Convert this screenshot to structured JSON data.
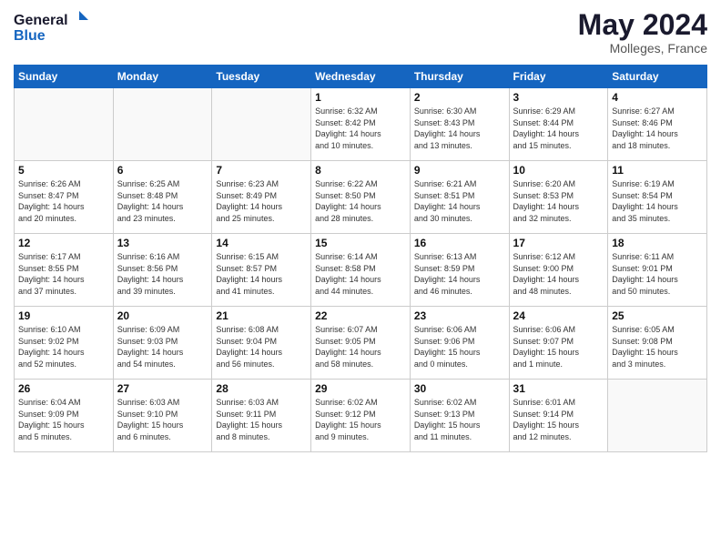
{
  "header": {
    "logo_general": "General",
    "logo_blue": "Blue",
    "month_year": "May 2024",
    "location": "Molleges, France"
  },
  "weekdays": [
    "Sunday",
    "Monday",
    "Tuesday",
    "Wednesday",
    "Thursday",
    "Friday",
    "Saturday"
  ],
  "weeks": [
    [
      {
        "day": "",
        "info": ""
      },
      {
        "day": "",
        "info": ""
      },
      {
        "day": "",
        "info": ""
      },
      {
        "day": "1",
        "info": "Sunrise: 6:32 AM\nSunset: 8:42 PM\nDaylight: 14 hours\nand 10 minutes."
      },
      {
        "day": "2",
        "info": "Sunrise: 6:30 AM\nSunset: 8:43 PM\nDaylight: 14 hours\nand 13 minutes."
      },
      {
        "day": "3",
        "info": "Sunrise: 6:29 AM\nSunset: 8:44 PM\nDaylight: 14 hours\nand 15 minutes."
      },
      {
        "day": "4",
        "info": "Sunrise: 6:27 AM\nSunset: 8:46 PM\nDaylight: 14 hours\nand 18 minutes."
      }
    ],
    [
      {
        "day": "5",
        "info": "Sunrise: 6:26 AM\nSunset: 8:47 PM\nDaylight: 14 hours\nand 20 minutes."
      },
      {
        "day": "6",
        "info": "Sunrise: 6:25 AM\nSunset: 8:48 PM\nDaylight: 14 hours\nand 23 minutes."
      },
      {
        "day": "7",
        "info": "Sunrise: 6:23 AM\nSunset: 8:49 PM\nDaylight: 14 hours\nand 25 minutes."
      },
      {
        "day": "8",
        "info": "Sunrise: 6:22 AM\nSunset: 8:50 PM\nDaylight: 14 hours\nand 28 minutes."
      },
      {
        "day": "9",
        "info": "Sunrise: 6:21 AM\nSunset: 8:51 PM\nDaylight: 14 hours\nand 30 minutes."
      },
      {
        "day": "10",
        "info": "Sunrise: 6:20 AM\nSunset: 8:53 PM\nDaylight: 14 hours\nand 32 minutes."
      },
      {
        "day": "11",
        "info": "Sunrise: 6:19 AM\nSunset: 8:54 PM\nDaylight: 14 hours\nand 35 minutes."
      }
    ],
    [
      {
        "day": "12",
        "info": "Sunrise: 6:17 AM\nSunset: 8:55 PM\nDaylight: 14 hours\nand 37 minutes."
      },
      {
        "day": "13",
        "info": "Sunrise: 6:16 AM\nSunset: 8:56 PM\nDaylight: 14 hours\nand 39 minutes."
      },
      {
        "day": "14",
        "info": "Sunrise: 6:15 AM\nSunset: 8:57 PM\nDaylight: 14 hours\nand 41 minutes."
      },
      {
        "day": "15",
        "info": "Sunrise: 6:14 AM\nSunset: 8:58 PM\nDaylight: 14 hours\nand 44 minutes."
      },
      {
        "day": "16",
        "info": "Sunrise: 6:13 AM\nSunset: 8:59 PM\nDaylight: 14 hours\nand 46 minutes."
      },
      {
        "day": "17",
        "info": "Sunrise: 6:12 AM\nSunset: 9:00 PM\nDaylight: 14 hours\nand 48 minutes."
      },
      {
        "day": "18",
        "info": "Sunrise: 6:11 AM\nSunset: 9:01 PM\nDaylight: 14 hours\nand 50 minutes."
      }
    ],
    [
      {
        "day": "19",
        "info": "Sunrise: 6:10 AM\nSunset: 9:02 PM\nDaylight: 14 hours\nand 52 minutes."
      },
      {
        "day": "20",
        "info": "Sunrise: 6:09 AM\nSunset: 9:03 PM\nDaylight: 14 hours\nand 54 minutes."
      },
      {
        "day": "21",
        "info": "Sunrise: 6:08 AM\nSunset: 9:04 PM\nDaylight: 14 hours\nand 56 minutes."
      },
      {
        "day": "22",
        "info": "Sunrise: 6:07 AM\nSunset: 9:05 PM\nDaylight: 14 hours\nand 58 minutes."
      },
      {
        "day": "23",
        "info": "Sunrise: 6:06 AM\nSunset: 9:06 PM\nDaylight: 15 hours\nand 0 minutes."
      },
      {
        "day": "24",
        "info": "Sunrise: 6:06 AM\nSunset: 9:07 PM\nDaylight: 15 hours\nand 1 minute."
      },
      {
        "day": "25",
        "info": "Sunrise: 6:05 AM\nSunset: 9:08 PM\nDaylight: 15 hours\nand 3 minutes."
      }
    ],
    [
      {
        "day": "26",
        "info": "Sunrise: 6:04 AM\nSunset: 9:09 PM\nDaylight: 15 hours\nand 5 minutes."
      },
      {
        "day": "27",
        "info": "Sunrise: 6:03 AM\nSunset: 9:10 PM\nDaylight: 15 hours\nand 6 minutes."
      },
      {
        "day": "28",
        "info": "Sunrise: 6:03 AM\nSunset: 9:11 PM\nDaylight: 15 hours\nand 8 minutes."
      },
      {
        "day": "29",
        "info": "Sunrise: 6:02 AM\nSunset: 9:12 PM\nDaylight: 15 hours\nand 9 minutes."
      },
      {
        "day": "30",
        "info": "Sunrise: 6:02 AM\nSunset: 9:13 PM\nDaylight: 15 hours\nand 11 minutes."
      },
      {
        "day": "31",
        "info": "Sunrise: 6:01 AM\nSunset: 9:14 PM\nDaylight: 15 hours\nand 12 minutes."
      },
      {
        "day": "",
        "info": ""
      }
    ]
  ]
}
